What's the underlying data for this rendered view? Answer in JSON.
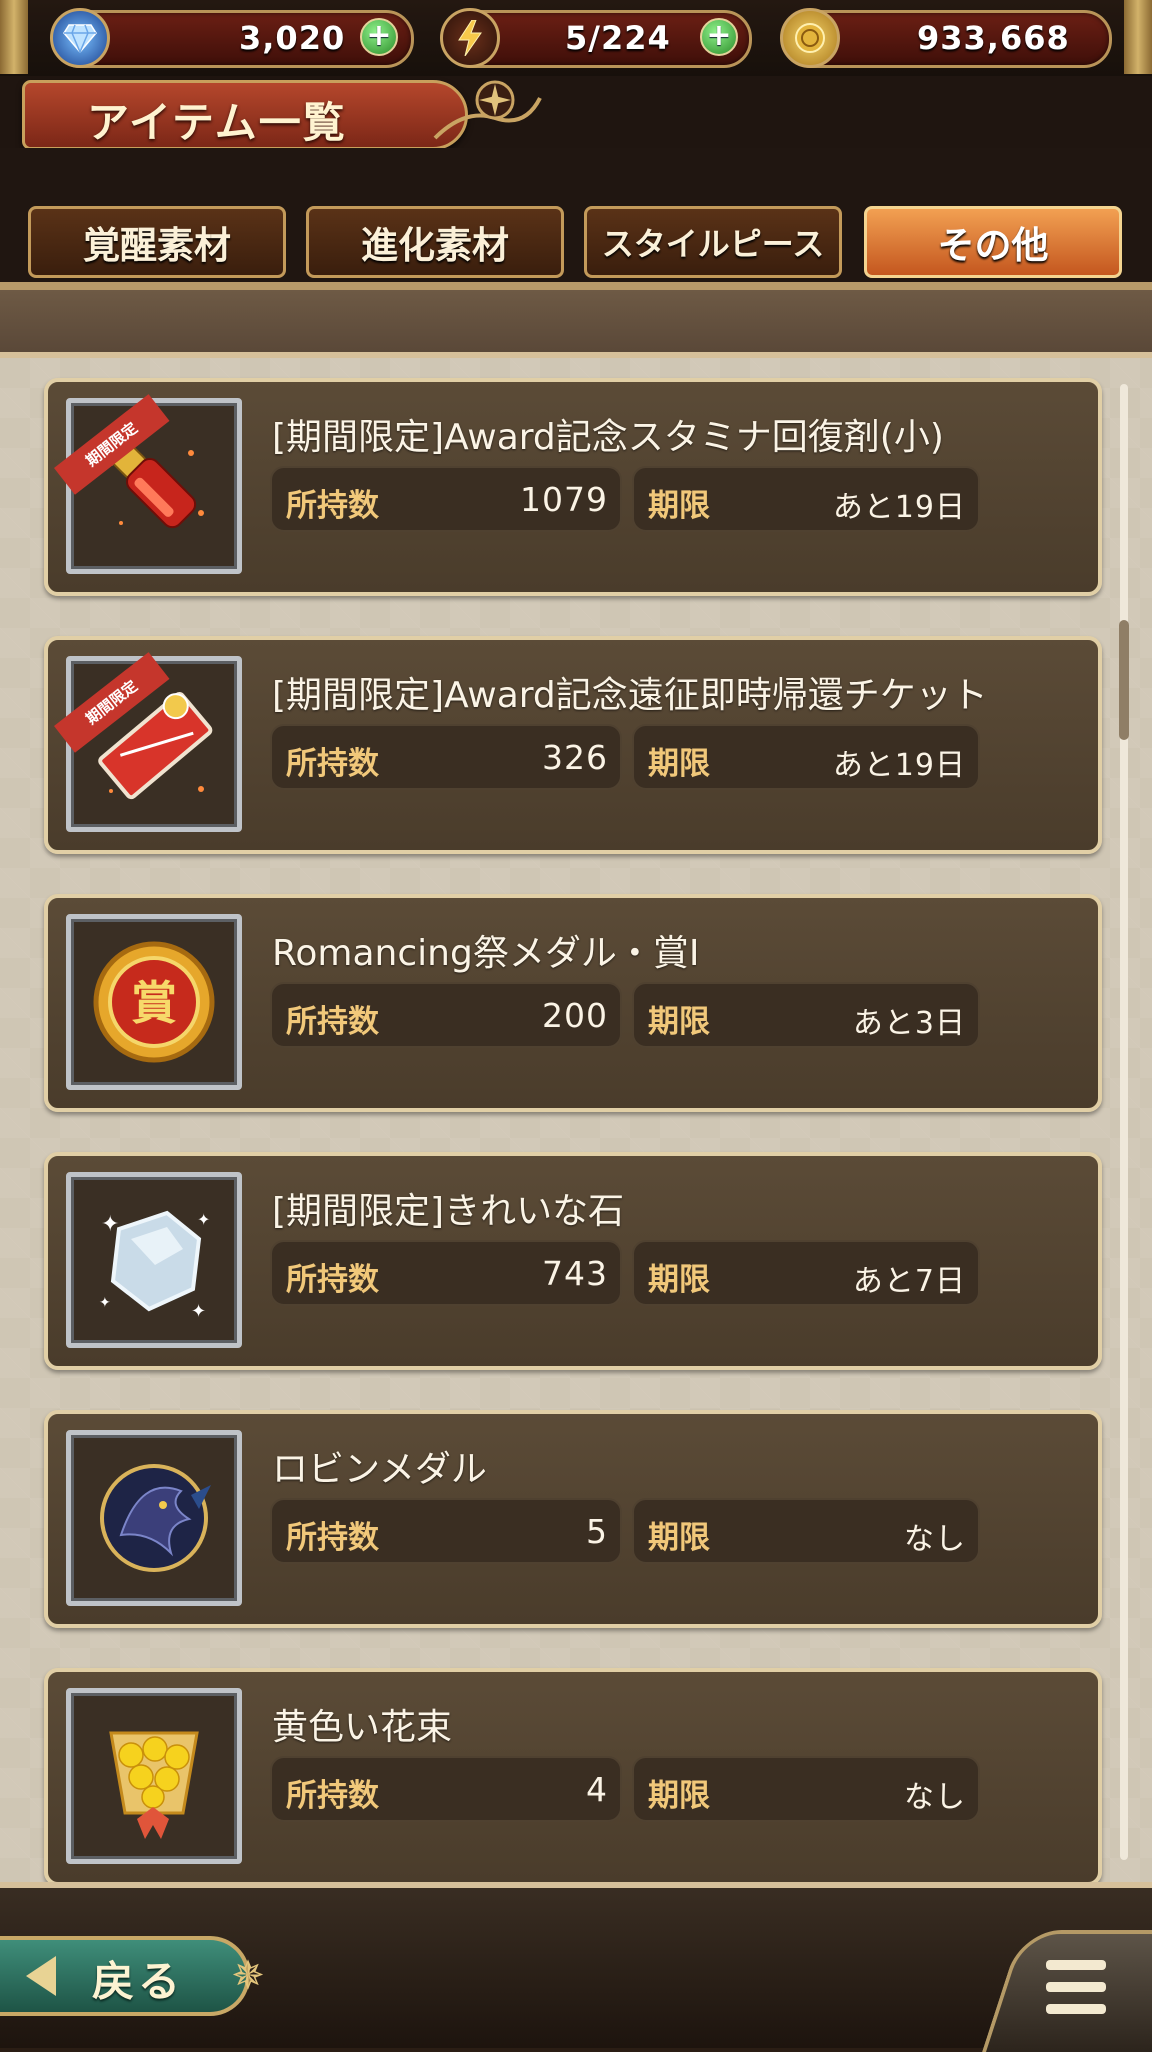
{
  "resources": {
    "gems": "3,020",
    "stamina": "5/224",
    "gold": "933,668"
  },
  "title": "アイテム一覧",
  "tabs": [
    {
      "label": "覚醒素材",
      "active": false
    },
    {
      "label": "進化素材",
      "active": false
    },
    {
      "label": "スタイルピース",
      "active": false
    },
    {
      "label": "その他",
      "active": true
    }
  ],
  "labels": {
    "owned": "所持数",
    "expiry": "期限",
    "limited_ribbon": "期間限定"
  },
  "items": [
    {
      "name": "[期間限定]Award記念スタミナ回復剤(小)",
      "owned": "1079",
      "expiry": "あと19日",
      "limited": true
    },
    {
      "name": "[期間限定]Award記念遠征即時帰還チケット",
      "owned": "326",
      "expiry": "あと19日",
      "limited": true
    },
    {
      "name": "Romancing祭メダル・賞Ⅰ",
      "owned": "200",
      "expiry": "あと3日",
      "limited": false
    },
    {
      "name": "[期間限定]きれいな石",
      "owned": "743",
      "expiry": "あと7日",
      "limited": false
    },
    {
      "name": "ロビンメダル",
      "owned": "5",
      "expiry": "なし",
      "limited": false
    },
    {
      "name": "黄色い花束",
      "owned": "4",
      "expiry": "なし",
      "limited": false
    }
  ],
  "bottom": {
    "back_label": "戻る"
  },
  "colors": {
    "accent_gold": "#c8a05c",
    "active_tab": "#e58a3c",
    "card_bg": "#4f402f",
    "label_gold": "#f1c87a"
  }
}
